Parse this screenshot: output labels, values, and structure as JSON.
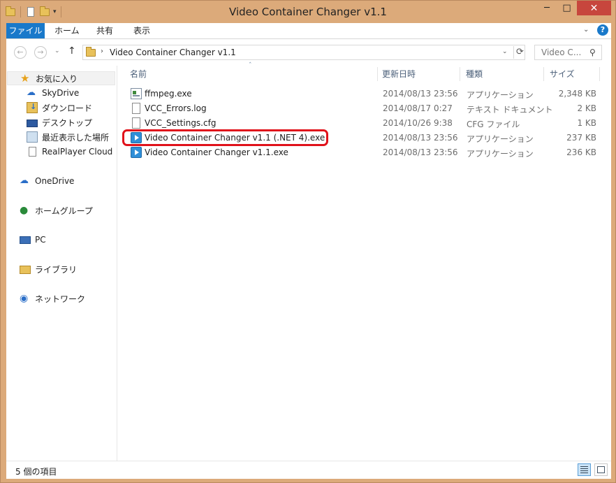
{
  "window": {
    "title": "Video Container Changer v1.1",
    "minimize": "─",
    "maximize": "□",
    "close": "✕"
  },
  "ribbon": {
    "tabs": [
      "ファイル",
      "ホーム",
      "共有",
      "表示"
    ],
    "help": "?",
    "collapse": "⌄"
  },
  "nav": {
    "back": "←",
    "forward": "→",
    "recent": "⌄",
    "up": "↑",
    "address_sep": "›",
    "path": "Video Container Changer v1.1",
    "address_dropdown": "⌄",
    "refresh": "⟳",
    "search_placeholder": "Video C...",
    "search_icon": "⚲"
  },
  "sidebar": {
    "favorites_label": "お気に入り",
    "favorites": [
      {
        "label": "SkyDrive",
        "icon": "cloud-icon"
      },
      {
        "label": "ダウンロード",
        "icon": "downloads-folder-icon"
      },
      {
        "label": "デスクトップ",
        "icon": "desktop-icon"
      },
      {
        "label": "最近表示した場所",
        "icon": "recent-places-icon"
      },
      {
        "label": "RealPlayer Cloud",
        "icon": "page-icon"
      }
    ],
    "groups": [
      {
        "label": "OneDrive",
        "icon": "onedrive-icon"
      },
      {
        "label": "ホームグループ",
        "icon": "homegroup-icon"
      },
      {
        "label": "PC",
        "icon": "pc-icon"
      },
      {
        "label": "ライブラリ",
        "icon": "library-icon"
      },
      {
        "label": "ネットワーク",
        "icon": "network-icon"
      }
    ]
  },
  "columns": {
    "name": "名前",
    "modified": "更新日時",
    "type": "種類",
    "size": "サイズ",
    "sort_arrow": "ˆ"
  },
  "files": [
    {
      "name": "ffmpeg.exe",
      "modified": "2014/08/13 23:56",
      "type": "アプリケーション",
      "size": "2,348 KB",
      "icon": "exe-icon"
    },
    {
      "name": "VCC_Errors.log",
      "modified": "2014/08/17 0:27",
      "type": "テキスト ドキュメント",
      "size": "2 KB",
      "icon": "text-file-icon"
    },
    {
      "name": "VCC_Settings.cfg",
      "modified": "2014/10/26 9:38",
      "type": "CFG ファイル",
      "size": "1 KB",
      "icon": "file-icon"
    },
    {
      "name": "Video Container Changer v1.1 (.NET 4).exe",
      "modified": "2014/08/13 23:56",
      "type": "アプリケーション",
      "size": "237 KB",
      "icon": "vcc-app-icon"
    },
    {
      "name": "Video Container Changer v1.1.exe",
      "modified": "2014/08/13 23:56",
      "type": "アプリケーション",
      "size": "236 KB",
      "icon": "vcc-app-icon"
    }
  ],
  "status": {
    "item_count": "5 個の項目"
  },
  "colors": {
    "frame": "#dcaa7a",
    "accent": "#1979ca",
    "close": "#c7463d",
    "highlight": "#e0121b"
  }
}
